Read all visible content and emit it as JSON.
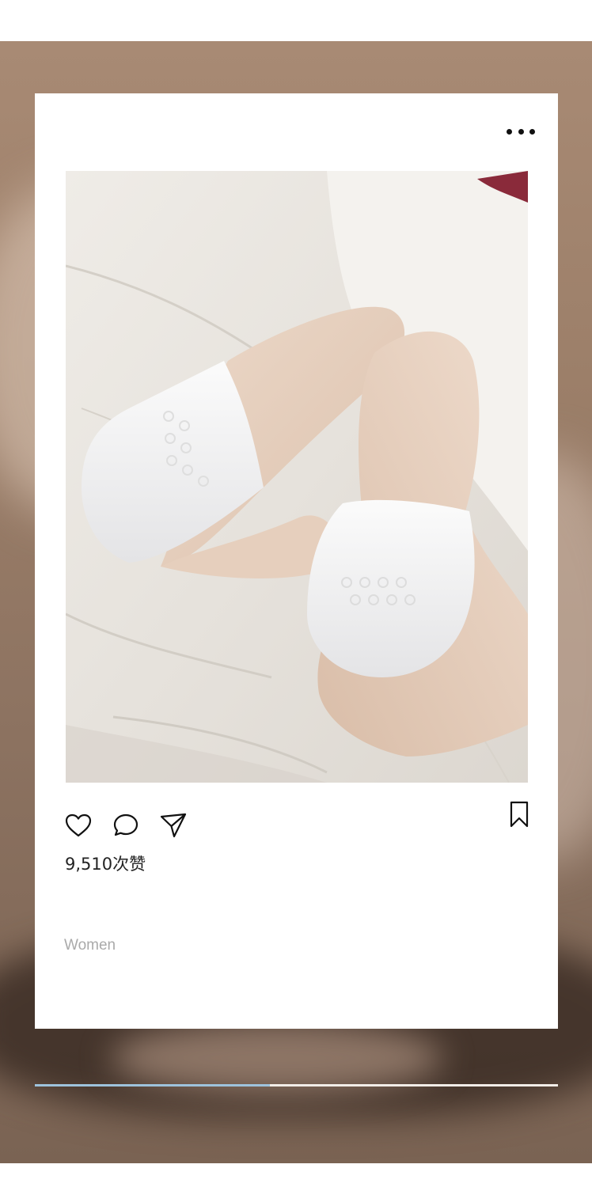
{
  "post": {
    "likes_text": "9,510次赞",
    "caption": "Women"
  },
  "icons": {
    "menu": "more-dots-icon",
    "like": "heart-icon",
    "comment": "comment-bubble-icon",
    "share": "send-paper-plane-icon",
    "save": "bookmark-icon"
  },
  "media": {
    "description_hidden": "photo-of-white-ankle-socks-on-bed"
  },
  "progress": {
    "fraction": 0.45
  },
  "colors": {
    "icon": "#111111",
    "caption": "#aaaaaa",
    "progress_fill": "#9ec3dd"
  }
}
